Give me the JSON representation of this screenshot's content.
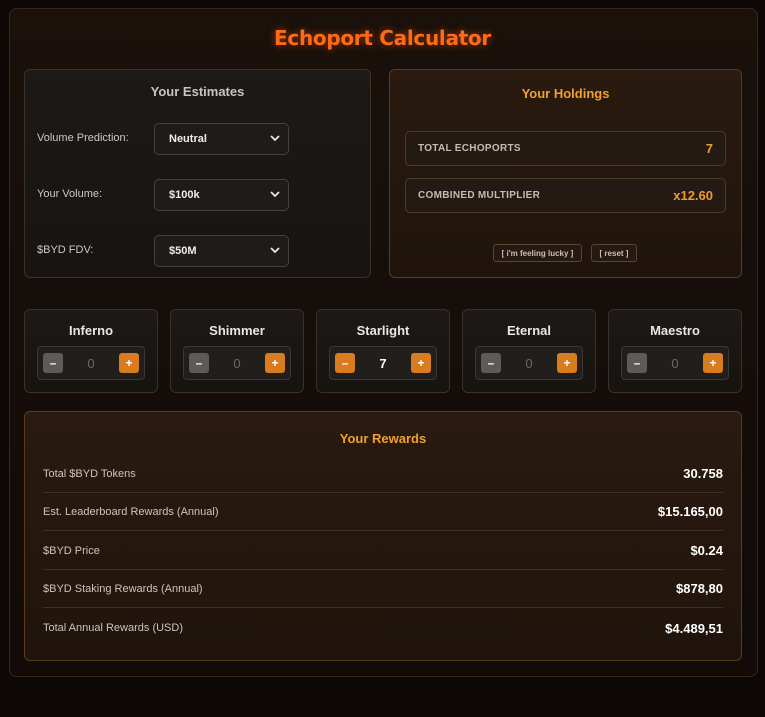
{
  "title": "Echoport Calculator",
  "estimates": {
    "title": "Your Estimates",
    "fields": [
      {
        "label": "Volume Prediction:",
        "value": "Neutral"
      },
      {
        "label": "Your Volume:",
        "value": "$100k"
      },
      {
        "label": "$BYD FDV:",
        "value": "$50M"
      }
    ]
  },
  "holdings": {
    "title": "Your Holdings",
    "total_label": "TOTAL ECHOPORTS",
    "total_value": "7",
    "multiplier_label": "COMBINED MULTIPLIER",
    "multiplier_value": "x12.60",
    "lucky_label": "[ i'm feeling lucky ]",
    "reset_label": "[ reset ]"
  },
  "echoports": [
    {
      "name": "Inferno",
      "count": "0",
      "minus": "–",
      "plus": "+"
    },
    {
      "name": "Shimmer",
      "count": "0",
      "minus": "–",
      "plus": "+"
    },
    {
      "name": "Starlight",
      "count": "7",
      "minus": "–",
      "plus": "+"
    },
    {
      "name": "Eternal",
      "count": "0",
      "minus": "–",
      "plus": "+"
    },
    {
      "name": "Maestro",
      "count": "0",
      "minus": "–",
      "plus": "+"
    }
  ],
  "rewards": {
    "title": "Your Rewards",
    "rows": [
      {
        "label": "Total $BYD Tokens",
        "value": "30.758"
      },
      {
        "label": "Est. Leaderboard Rewards (Annual)",
        "value": "$15.165,00"
      },
      {
        "label": "$BYD Price",
        "value": "$0.24"
      },
      {
        "label": "$BYD Staking Rewards (Annual)",
        "value": "$878,80"
      },
      {
        "label": "Total Annual Rewards (USD)",
        "value": "$4.489,51"
      }
    ]
  },
  "colors": {
    "accent": "#ff6a1a",
    "gold": "#f2a02a",
    "button": "#d97b1f"
  }
}
